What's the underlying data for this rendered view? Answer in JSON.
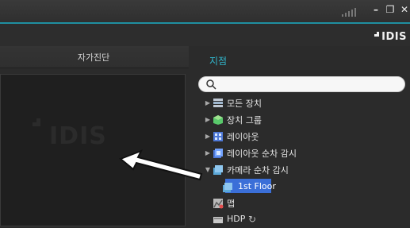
{
  "window": {
    "title_controls": {
      "minimize_label": "–",
      "restore_label": "❐",
      "close_label": "✕"
    },
    "brand_text": "IDIS"
  },
  "left_panel": {
    "tab_title": "자가진단",
    "watermark_text": "IDIS"
  },
  "right_panel": {
    "section_title": "지점",
    "search": {
      "value": "",
      "placeholder": ""
    },
    "tree_items": [
      {
        "label": "모든 장치",
        "icon_name": "all-devices-icon",
        "has_expander": true,
        "expander_state": "collapsed"
      },
      {
        "label": "장치 그룹",
        "icon_name": "device-group-icon",
        "has_expander": true,
        "expander_state": "collapsed"
      },
      {
        "label": "레이아웃",
        "icon_name": "layout-icon",
        "has_expander": true,
        "expander_state": "collapsed"
      },
      {
        "label": "레이아웃 순차 감시",
        "icon_name": "layout-sequence-icon",
        "has_expander": true,
        "expander_state": "collapsed"
      },
      {
        "label": "카메라 순차 감시",
        "icon_name": "camera-sequence-icon",
        "has_expander": true,
        "expander_state": "expanded"
      },
      {
        "label": "1st Floor",
        "icon_name": "camera-sequence-item-icon",
        "has_expander": false,
        "selected": true
      },
      {
        "label": "맵",
        "icon_name": "map-icon",
        "has_expander": false
      },
      {
        "label": "HDP",
        "icon_name": "hdp-icon",
        "has_expander": false,
        "refresh_icon": "refresh-icon"
      }
    ]
  },
  "colors": {
    "accent": "#31b9cf",
    "selection": "#3b6fd8",
    "title_border": "#1f8fa0"
  }
}
